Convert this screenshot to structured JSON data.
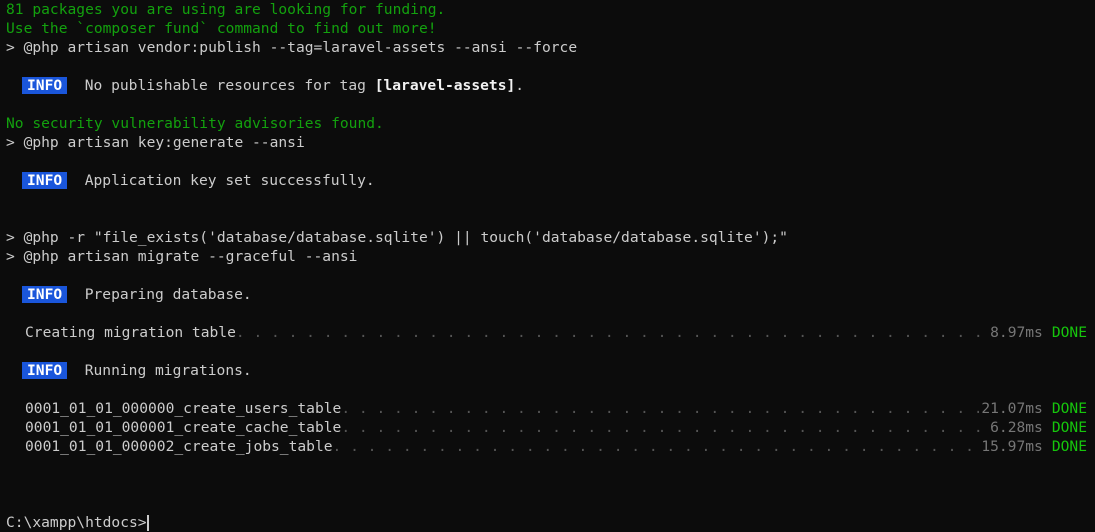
{
  "terminal": {
    "background_color": "#0c0c0c",
    "foreground_color": "#cccccc",
    "prompt": "C:\\xampp\\htdocs>",
    "colors": {
      "green": "#13a10e",
      "green_bright": "#16c60c",
      "info_badge_bg": "#1a56db",
      "dim": "#767676",
      "dots": "#555555"
    }
  },
  "composer": {
    "funding_line": "81 packages you are using are looking for funding.",
    "funding_hint": "Use the `composer fund` command to find out more!",
    "security_line": "No security vulnerability advisories found."
  },
  "commands": {
    "vendor_publish": "> @php artisan vendor:publish --tag=laravel-assets --ansi --force",
    "key_generate": "> @php artisan key:generate --ansi",
    "file_exists": "> @php -r \"file_exists('database/database.sqlite') || touch('database/database.sqlite');\"",
    "migrate": "> @php artisan migrate --graceful --ansi"
  },
  "info_label": "INFO",
  "messages": {
    "no_publishable_pre": "No publishable resources for tag ",
    "no_publishable_tag": "[laravel-assets]",
    "no_publishable_post": ".",
    "app_key": "Application key set successfully.",
    "preparing_db": "Preparing database.",
    "running_migrations": "Running migrations."
  },
  "migration_rows": [
    {
      "label": "Creating migration table",
      "time": "8.97ms",
      "status": "DONE"
    },
    {
      "label": "0001_01_01_000000_create_users_table",
      "time": "21.07ms",
      "status": "DONE"
    },
    {
      "label": "0001_01_01_000001_create_cache_table",
      "time": "6.28ms",
      "status": "DONE"
    },
    {
      "label": "0001_01_01_000002_create_jobs_table",
      "time": "15.97ms",
      "status": "DONE"
    }
  ],
  "leader_dots": ". . . . . . . . . . . . . . . . . . . . . . . . . . . . . . . . . . . . . . . . . . . . . . . . . . . . . . . . . . . . . . . . . . . . . . . . . . . . . . . . . . . . . . . . . . . . . . . . . . . . . . . . . . . . . . . . . . . . . . . . . . . . . . . . . . . . . . . . . . . . . . . . . . . . . . . . . . . . . . . . . . . . . . . . . . . . . . . ."
}
